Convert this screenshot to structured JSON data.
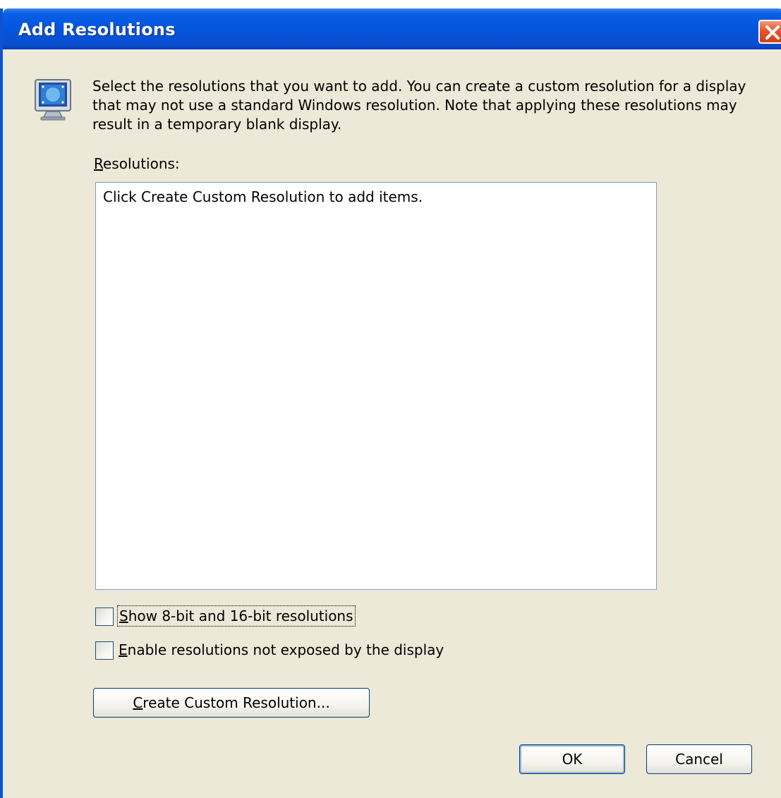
{
  "window": {
    "title": "Add Resolutions"
  },
  "icons": {
    "close": "close-icon",
    "monitor": "monitor-icon"
  },
  "description": "Select the resolutions that you want to add. You can create a custom resolution for a display that may not use a standard Windows resolution. Note that applying these resolutions may result in a temporary blank display.",
  "resolutions": {
    "label_mnemonic": "R",
    "label_rest": "esolutions:",
    "empty_hint": "Click Create Custom Resolution to add items."
  },
  "options": {
    "show_8bit_16bit": {
      "mnemonic": "S",
      "label_rest": "how 8-bit and 16-bit resolutions",
      "checked": false
    },
    "enable_not_exposed": {
      "mnemonic": "E",
      "label_rest": "nable resolutions not exposed by the display",
      "checked": false
    }
  },
  "buttons": {
    "create_custom": {
      "mnemonic": "C",
      "label_rest": "reate Custom Resolution..."
    },
    "ok": "OK",
    "cancel": "Cancel"
  },
  "colors": {
    "titlebar": "#0454dd",
    "dialog_bg": "#ece9d8",
    "close_button": "#e4552c"
  }
}
